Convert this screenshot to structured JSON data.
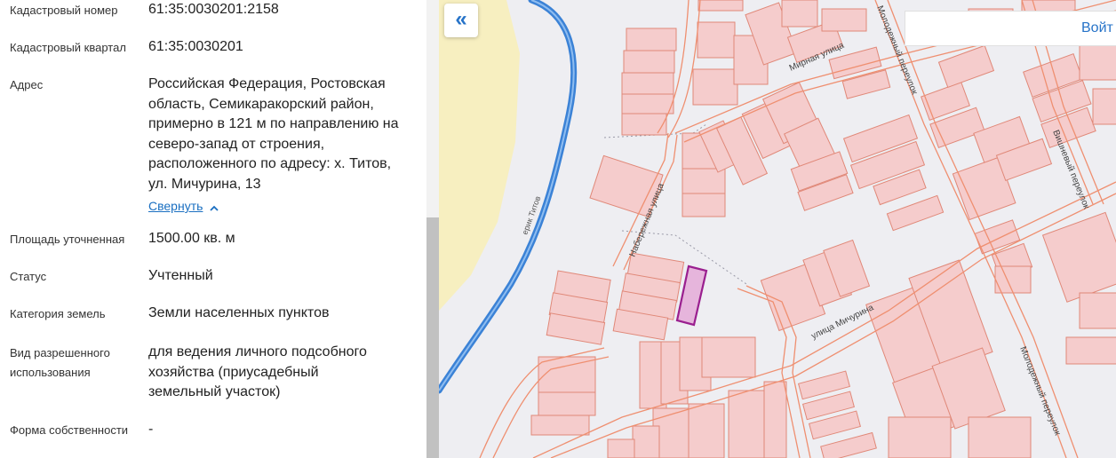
{
  "info": {
    "cadastral_number": {
      "label": "Кадастровый номер",
      "value": "61:35:0030201:2158"
    },
    "cadastral_quarter": {
      "label": "Кадастровый квартал",
      "value": "61:35:0030201"
    },
    "address": {
      "label": "Адрес",
      "lines": [
        "Российская Федерация, Ростовская",
        "область, Семикаракорский район,",
        "примерно в 121 м по направлению на",
        "северо-запад от строения,",
        "расположенного по адресу: х. Титов,",
        "ул. Мичурина, 13"
      ],
      "collapse_label": "Свернуть"
    },
    "area": {
      "label": "Площадь уточненная",
      "value": "1500.00 кв. м"
    },
    "status": {
      "label": "Статус",
      "value": "Учтенный"
    },
    "land_category": {
      "label": "Категория земель",
      "value": "Земли населенных пунктов"
    },
    "permitted_use": {
      "label_lines": [
        "Вид разрешенного",
        "использования"
      ],
      "value_lines": [
        "для ведения личного подсобного",
        "хозяйства (приусадебный",
        "земельный участок)"
      ]
    },
    "ownership": {
      "label": "Форма собственности",
      "value": "-"
    }
  },
  "map": {
    "collapse_icon": "«",
    "login_label": "Войт",
    "street_labels": {
      "mirnaya": "Мирная улица",
      "naberezhnaya": "Набережная улица",
      "michurina": "улица Мичурина",
      "molodezhny_top": "Молодежный переулок",
      "molodezhny_bottom": "Молодежный переулок",
      "vishnevy": "Вишневый переулок",
      "canal": "ерик Титов"
    },
    "colors": {
      "parcel_fill": "#f5cccc",
      "parcel_stroke": "#e08878",
      "selected_fill": "#e6b5dc",
      "selected_stroke": "#9a1f8f",
      "river": "#3b82d6",
      "field": "#f7efc0",
      "road": "#ef8f70",
      "accent": "#2673c8"
    }
  }
}
